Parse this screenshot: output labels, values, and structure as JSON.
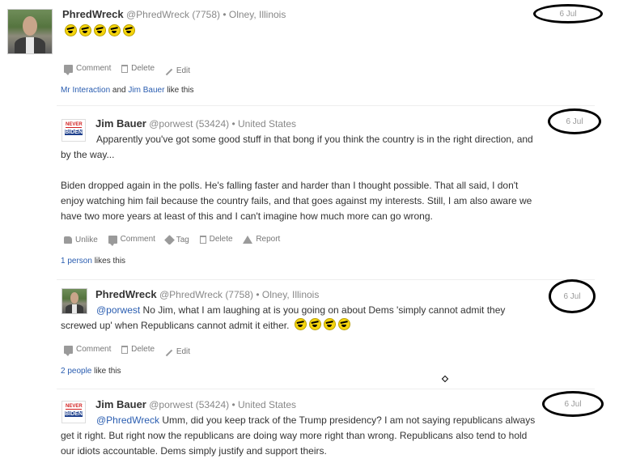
{
  "posts": [
    {
      "author": "PhredWreck",
      "handle": "@PhredWreck",
      "points": "(7758)",
      "location": "• Olney, Illinois",
      "date": "6 Jul",
      "actions": [
        "Comment",
        "Delete",
        "Edit"
      ],
      "likes": {
        "link1": "Mr Interaction",
        "mid": "and",
        "link2": "Jim Bauer",
        "suffix": "like this"
      }
    },
    {
      "author": "Jim Bauer",
      "handle": "@porwest",
      "points": "(53424)",
      "location": "• United States",
      "date": "6 Jul",
      "body_line1": "Apparently you've got some good stuff in that bong if you think the country is in the right direction, and",
      "body_line2": "by the way...",
      "body_line3": "Biden dropped again in the polls. He's falling faster and harder than I thought possible. That all said, I don't",
      "body_line4": "enjoy watching him fail because the country fails, and that goes against my interests. Still, I am also aware we",
      "body_line5": "have two more years at least of this and I can't imagine how much more can go wrong.",
      "actions": [
        "Unlike",
        "Comment",
        "Tag",
        "Delete",
        "Report"
      ],
      "likes": {
        "link": "1 person",
        "suffix": "likes this"
      }
    },
    {
      "author": "PhredWreck",
      "handle": "@PhredWreck",
      "points": "(7758)",
      "location": "• Olney, Illinois",
      "date": "6 Jul",
      "mention": "@porwest",
      "body_line1": "No Jim, what I am laughing at is you going on about Dems 'simply cannot admit they",
      "body_line2": "screwed up' when Republicans cannot admit it either.",
      "actions": [
        "Comment",
        "Delete",
        "Edit"
      ],
      "likes": {
        "link": "2 people",
        "suffix": "like this"
      }
    },
    {
      "author": "Jim Bauer",
      "handle": "@porwest",
      "points": "(53424)",
      "location": "• United States",
      "date": "6 Jul",
      "mention": "@PhredWreck",
      "body_line1": "Umm, did you keep track of the Trump presidency? I am not saying republicans always",
      "body_line2": "get it right. But right now the republicans are doing way more right than wrong. Republicans also tend to hold",
      "body_line3": "our idiots accountable. Dems simply justify and support theirs."
    }
  ],
  "sign_avatar": {
    "top": "NEVER",
    "bottom": "BIDEN"
  }
}
